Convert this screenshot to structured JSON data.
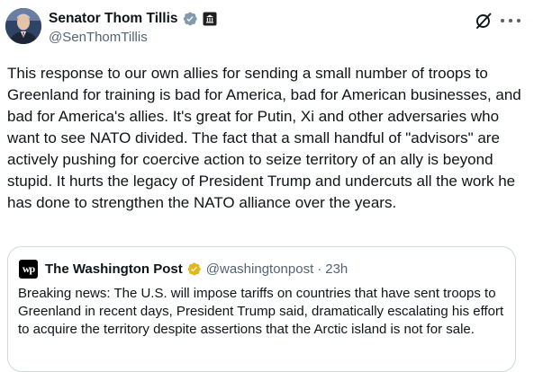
{
  "author": {
    "name": "Senator Thom Tillis",
    "handle": "@SenThomTillis",
    "verified_badge_color": "#829aab",
    "avatar_icon": "senator-portrait"
  },
  "actions": {
    "grok_icon": "grok-icon",
    "more_icon": "more-options-icon"
  },
  "tweet": {
    "text": "This response to our own allies for sending a small number of troops to Greenland for training is bad for America, bad for American businesses, and bad for America's allies. It's great for Putin, Xi and other adversaries who want to see NATO divided. The fact that a small handful of \"advisors\" are actively pushing for coercive action to seize territory of an ally is beyond stupid. It hurts the legacy of President Trump and undercuts all the work he has done to strengthen the NATO alliance over the years."
  },
  "quoted_tweet": {
    "logo_text": "wp",
    "name": "The Washington Post",
    "verified_badge_color": "#e2b719",
    "handle": "@washingtonpost",
    "separator": "·",
    "time": "23h",
    "text": "Breaking news: The U.S. will impose tariffs on countries that have sent troops to Greenland in recent days, President Trump said, dramatically escalating his effort to acquire the territory despite assertions that the Arctic island is not for sale."
  },
  "colors": {
    "text_primary": "#0f1419",
    "text_secondary": "#536471",
    "border": "#cfd9de"
  }
}
